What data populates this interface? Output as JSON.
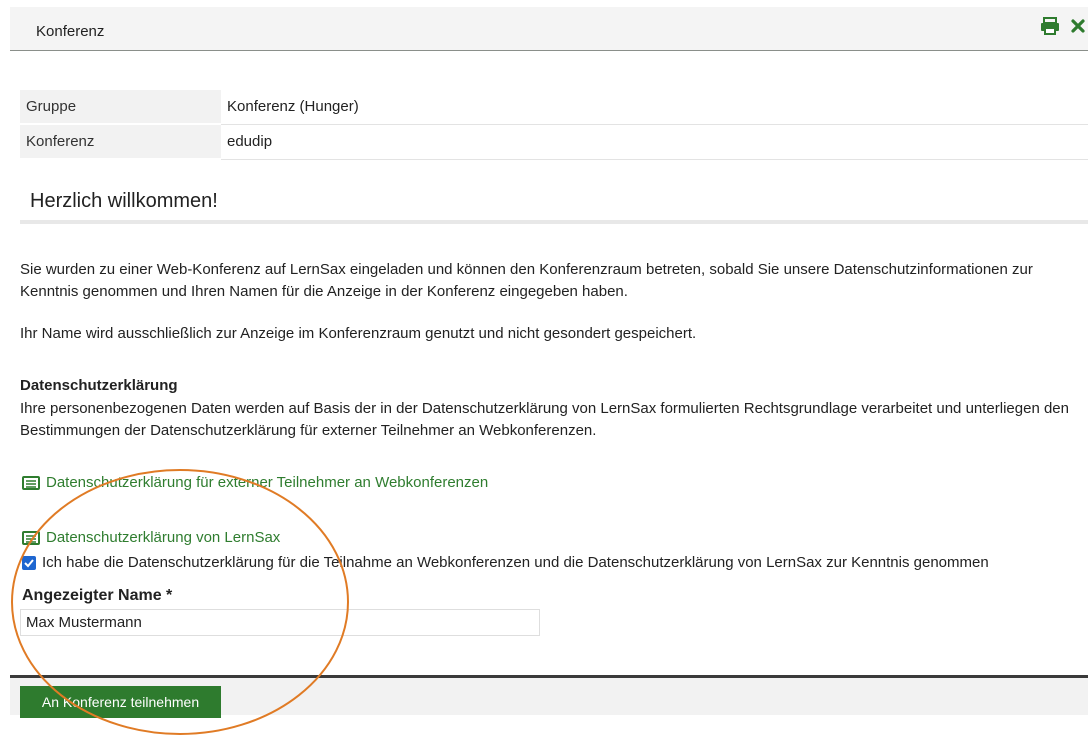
{
  "header": {
    "title": "Konferenz",
    "print_icon": "print-icon",
    "close_icon": "close-icon",
    "accent": "#2e7b2e"
  },
  "info": [
    {
      "label": "Gruppe",
      "value": "Konferenz (Hunger)"
    },
    {
      "label": "Konferenz",
      "value": "edudip"
    }
  ],
  "welcome": {
    "title": "Herzlich willkommen!"
  },
  "intro": {
    "p1": "Sie wurden zu einer Web-Konferenz auf LernSax eingeladen und können den Konferenzraum betreten, sobald Sie unsere Datenschutzinformationen zur Kenntnis genommen und Ihren Namen für die Anzeige in der Konferenz eingegeben haben.",
    "p2": "Ihr Name wird ausschließlich zur Anzeige im Konferenzraum genutzt und nicht gesondert gespeichert."
  },
  "privacy": {
    "heading": "Datenschutzerklärung",
    "text": "Ihre personenbezogenen Daten werden auf Basis der in der Datenschutzerklärung von LernSax formulierten Rechtsgrundlage verarbeitet und unterliegen den Bestimmungen der Datenschutzerklärung für externer Teilnehmer an Webkonferenzen.",
    "link_external": "Datenschutzerklärung für externer Teilnehmer an Webkonferenzen",
    "link_lernsax": "Datenschutzerklärung von LernSax",
    "consent_label": "Ich habe die Datenschutzerklärung für die Teilnahme an Webkonferenzen und die Datenschutzerklärung von LernSax zur Kenntnis genommen",
    "consent_checked": true
  },
  "name_field": {
    "label": "Angezeigter Name *",
    "value": "Max Mustermann"
  },
  "footer": {
    "submit_label": "An Konferenz teilnehmen"
  },
  "annotation": {
    "color": "#e07b25"
  }
}
